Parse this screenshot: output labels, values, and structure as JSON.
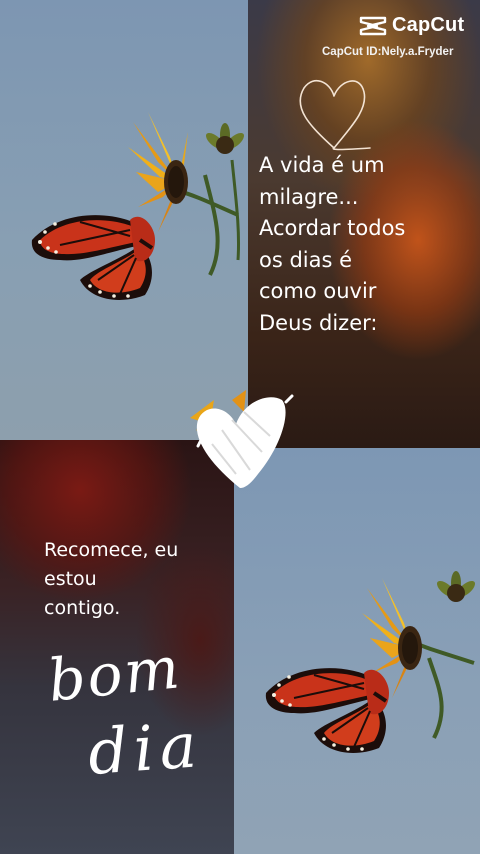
{
  "watermark": {
    "brand": "CapCut",
    "id_text": "CapCut ID:Nely.a.Fryder",
    "icon": "capcut-logo-icon"
  },
  "quote_top": {
    "lines": [
      "A vida é um",
      "milagre...",
      "Acordar todos",
      "os dias é",
      "como ouvir",
      "Deus dizer:"
    ]
  },
  "quote_bottom": {
    "lines": [
      "Recomece, eu",
      "estou",
      "contigo."
    ]
  },
  "script_text": {
    "line1": "bom",
    "line2": "dia"
  },
  "icons": {
    "outline_heart": "heart-outline-icon",
    "brush_heart": "heart-brush-icon"
  },
  "colors": {
    "sky": "#8aa0b6",
    "wing_orange": "#c9331a",
    "petal_yellow": "#f0b01a",
    "text": "#ffffff"
  }
}
